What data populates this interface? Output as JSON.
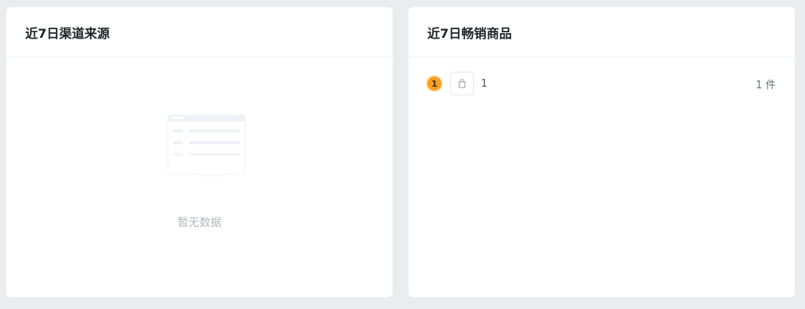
{
  "channel_card": {
    "title": "近7日渠道来源",
    "empty_text": "暂无数据",
    "illustration": "empty-list-illustration"
  },
  "bestseller_card": {
    "title": "近7日畅销商品",
    "items": [
      {
        "rank": "1",
        "thumb_icon": "shopping-bag-icon",
        "name": "1",
        "quantity": "1 件"
      }
    ]
  },
  "colors": {
    "page_bg": "#eaecef",
    "card_bg": "#ffffff",
    "rank_badge": "#f5a122",
    "muted_text": "#b4b8bf"
  }
}
